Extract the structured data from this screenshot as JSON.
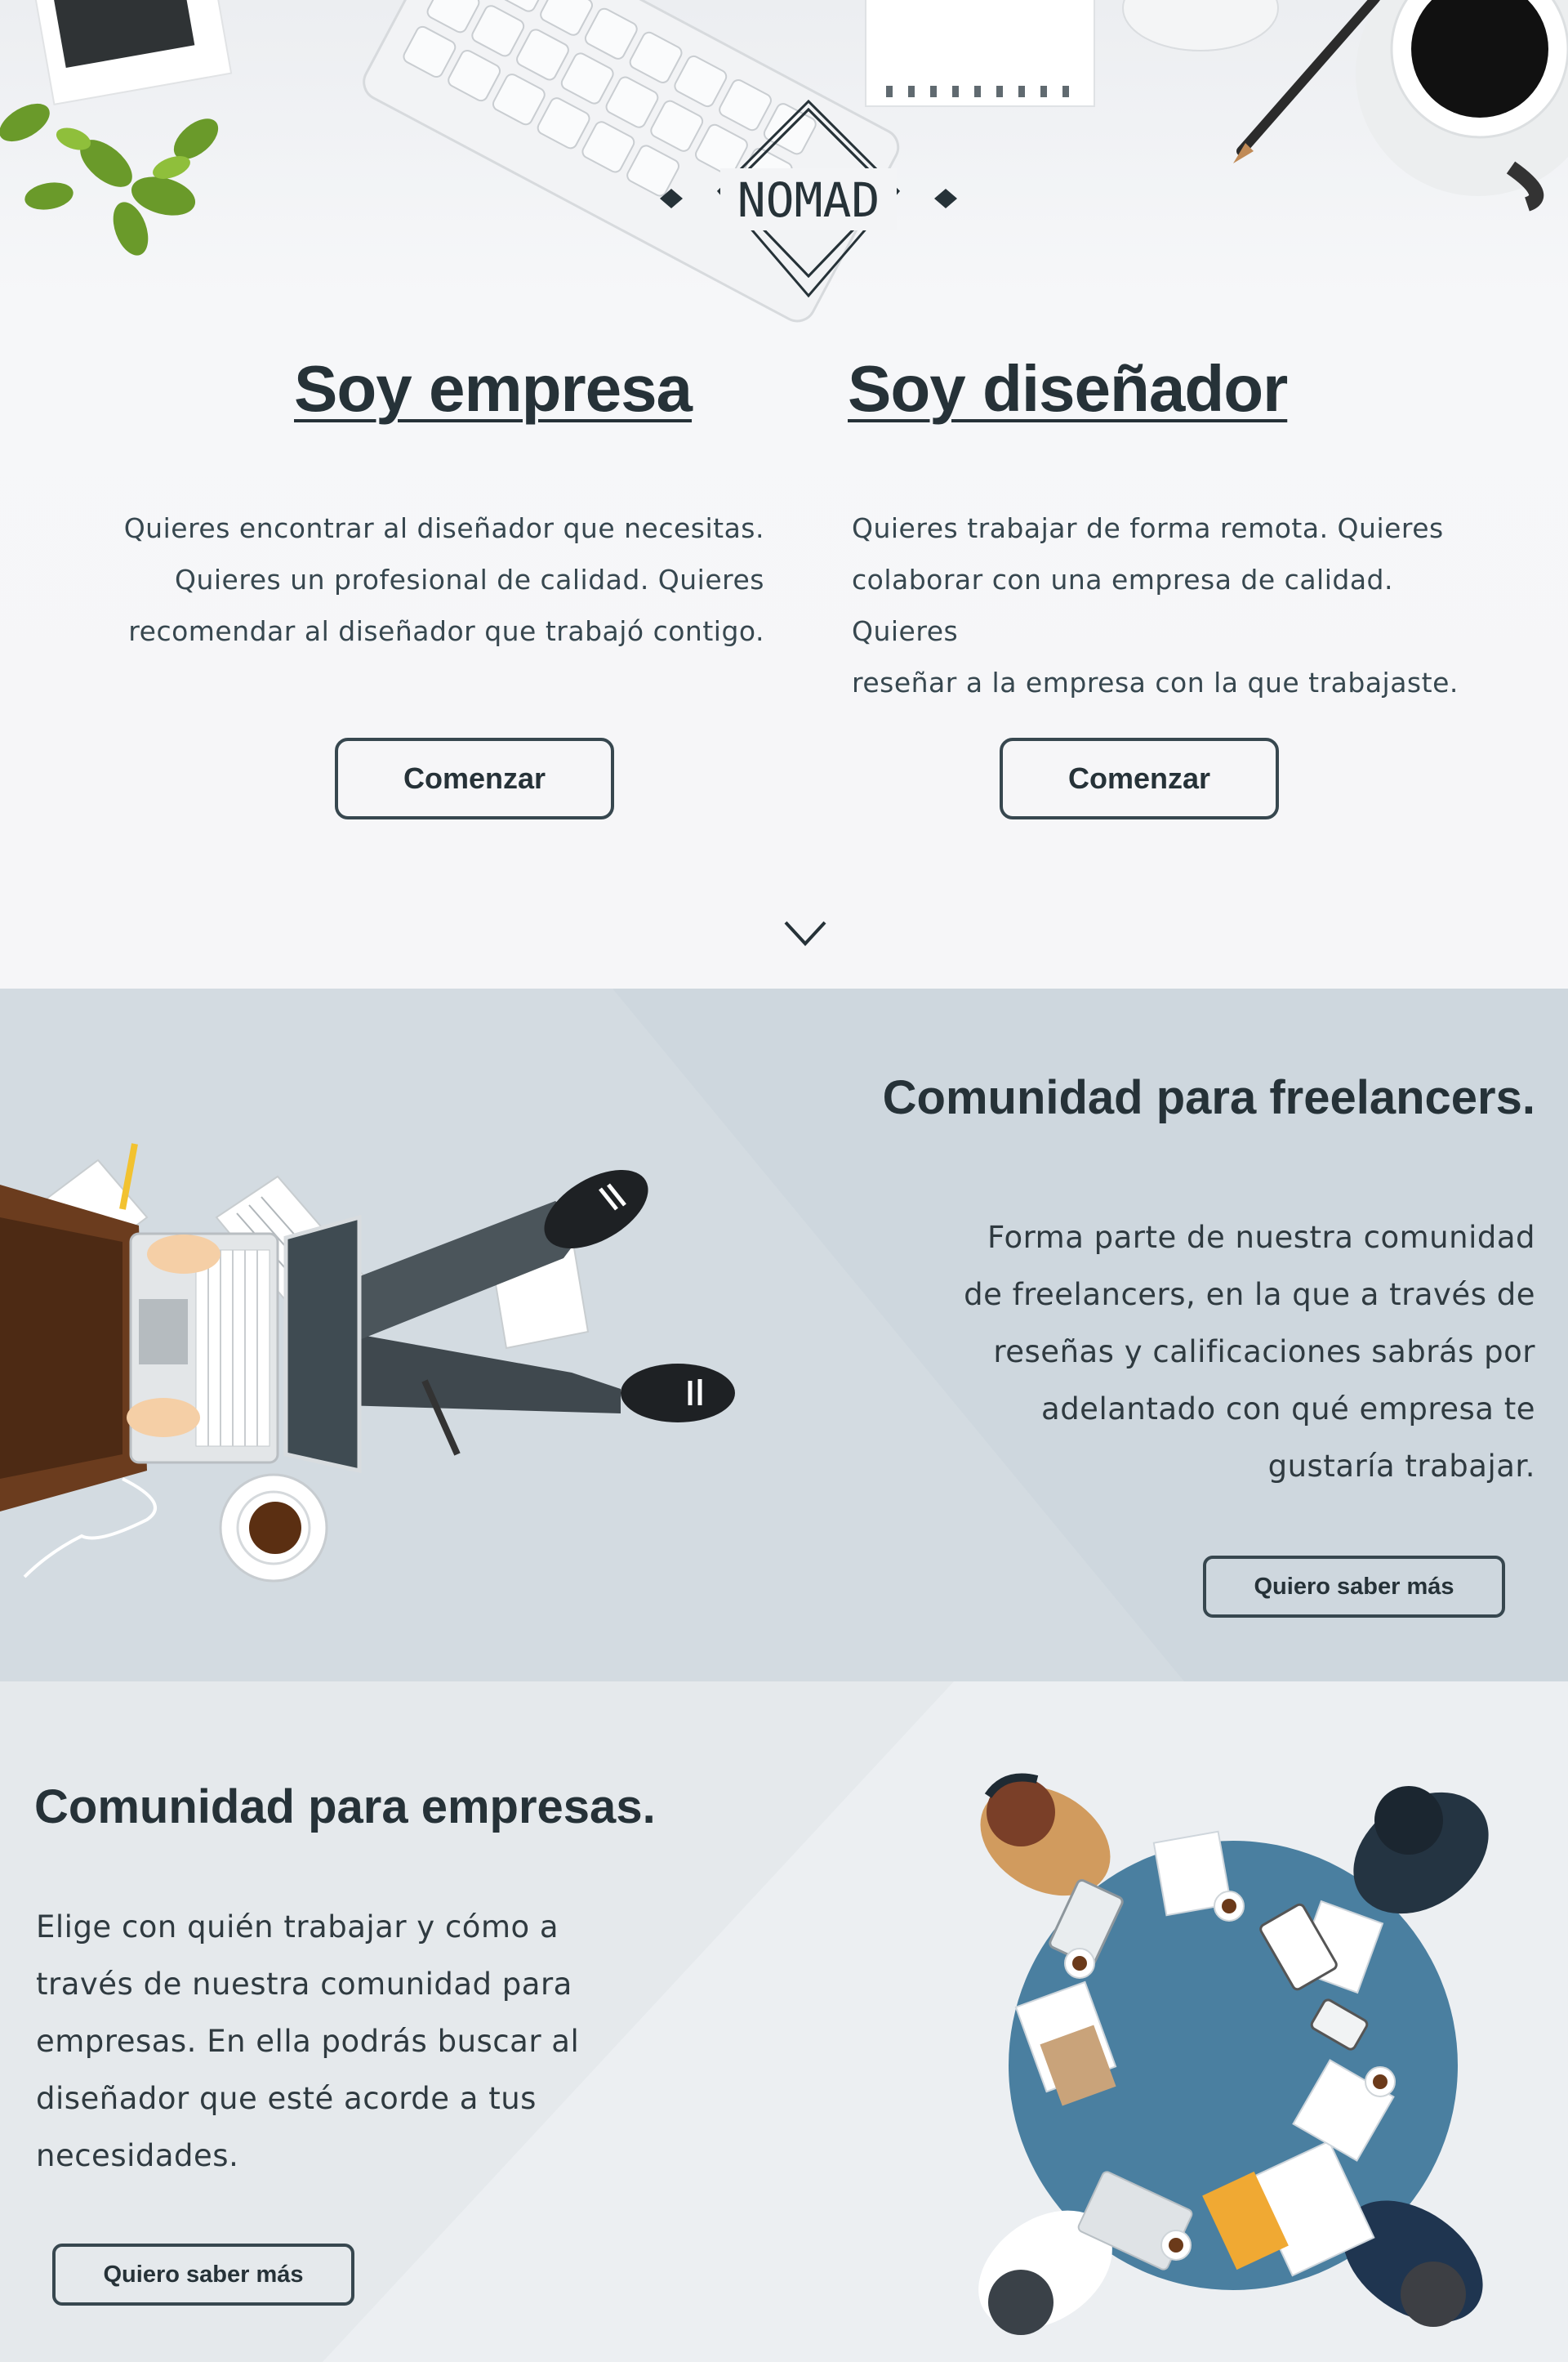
{
  "brand": {
    "logo_text": "NOMAD"
  },
  "hero": {
    "company": {
      "title": "Soy empresa",
      "lines": [
        "Quieres encontrar al diseñador que necesitas.",
        "Quieres un profesional de calidad. Quieres",
        "recomendar al diseñador que trabajó contigo."
      ],
      "button_label": "Comenzar"
    },
    "designer": {
      "title": "Soy diseñador",
      "lines": [
        "Quieres trabajar de forma remota. Quieres",
        "colaborar con una empresa de calidad. Quieres",
        "reseñar a la empresa con la que trabajaste."
      ],
      "button_label": "Comenzar"
    }
  },
  "freelancers": {
    "title": "Comunidad para freelancers.",
    "lines": [
      "Forma parte de nuestra comunidad",
      "de freelancers, en la que a través de",
      "reseñas y calificaciones sabrás por",
      "adelantado con qué empresa te",
      "gustaría trabajar."
    ],
    "button_label": "Quiero saber más"
  },
  "companies": {
    "title": "Comunidad para empresas.",
    "lines": [
      "Elige con quién trabajar y cómo a",
      "través de nuestra comunidad para",
      "empresas. En ella podrás buscar al",
      "diseñador que esté acorde a tus",
      "necesidades."
    ],
    "button_label": "Quiero saber más"
  },
  "icons": [
    "chevron-down-icon"
  ],
  "colors": {
    "text": "#263238",
    "band_light": "#d3dbe1",
    "table": "#4a7fa0"
  }
}
